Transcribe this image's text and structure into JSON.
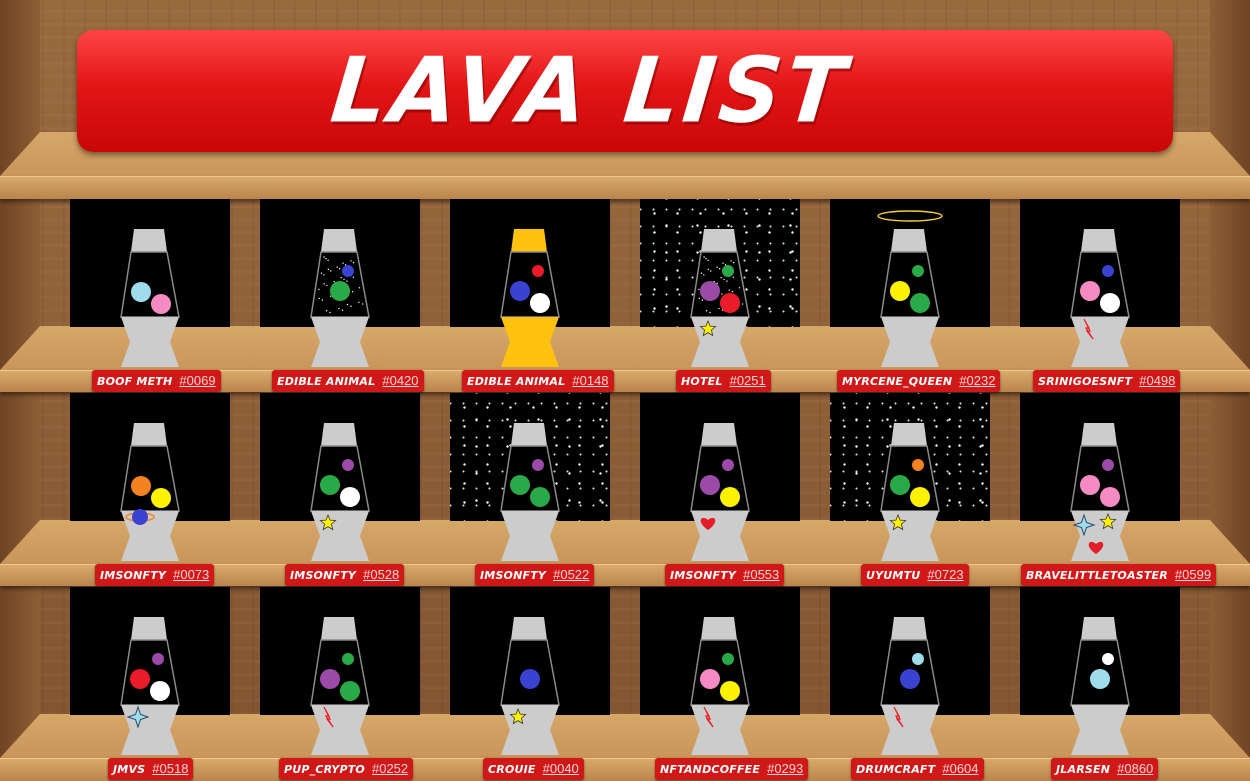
{
  "title": "LAVA LIST",
  "colors": {
    "banner": "#e31616",
    "tag": "#d01818",
    "glass": "#cccccc",
    "gold": "#ffc20e",
    "shelf": "#d6a868"
  },
  "lamps": [
    {
      "owner": "BOOF METH",
      "number": "#0069",
      "background": "black",
      "cap": "silver",
      "halo": false,
      "glitter": false,
      "blobs": [
        {
          "color": "#9fdcec",
          "size": "small"
        },
        {
          "color": "#f68bc4",
          "size": "small"
        }
      ],
      "decals": []
    },
    {
      "owner": "EDIBLE ANIMAL",
      "number": "#0420",
      "background": "black",
      "cap": "silver",
      "halo": false,
      "glitter": true,
      "blobs": [
        {
          "color": "#3a43d1",
          "size": "tiny"
        },
        {
          "color": "#29a948",
          "size": "small"
        }
      ],
      "decals": []
    },
    {
      "owner": "EDIBLE ANIMAL",
      "number": "#0148",
      "background": "black",
      "cap": "gold",
      "halo": false,
      "glitter": false,
      "blobs": [
        {
          "color": "#ea1c2a",
          "size": "tiny"
        },
        {
          "color": "#3a43d1",
          "size": "small"
        },
        {
          "color": "#ffffff",
          "size": "small"
        }
      ],
      "decals": []
    },
    {
      "owner": "HOTEL",
      "number": "#0251",
      "background": "stars",
      "cap": "silver",
      "halo": false,
      "glitter": true,
      "blobs": [
        {
          "color": "#29a948",
          "size": "tiny"
        },
        {
          "color": "#9b4aa8",
          "size": "small"
        },
        {
          "color": "#ea1c2a",
          "size": "small"
        }
      ],
      "decals": [
        "star-icon"
      ]
    },
    {
      "owner": "MYRCENE_QUEEN",
      "number": "#0232",
      "background": "black",
      "cap": "silver",
      "halo": true,
      "glitter": false,
      "blobs": [
        {
          "color": "#29a948",
          "size": "tiny"
        },
        {
          "color": "#fff200",
          "size": "small"
        },
        {
          "color": "#29a948",
          "size": "small"
        }
      ],
      "decals": []
    },
    {
      "owner": "SRINIGOESNFT",
      "number": "#0498",
      "background": "black",
      "cap": "silver",
      "halo": false,
      "glitter": false,
      "blobs": [
        {
          "color": "#3a43d1",
          "size": "tiny"
        },
        {
          "color": "#f68bc4",
          "size": "small"
        },
        {
          "color": "#ffffff",
          "size": "small"
        }
      ],
      "decals": [
        "lightning-icon"
      ]
    },
    {
      "owner": "IMSONFTY",
      "number": "#0073",
      "background": "black",
      "cap": "silver",
      "halo": false,
      "glitter": false,
      "blobs": [
        {
          "color": "#f58220",
          "size": "small"
        },
        {
          "color": "#fff200",
          "size": "small"
        }
      ],
      "decals": [
        "planet-icon"
      ]
    },
    {
      "owner": "IMSONFTY",
      "number": "#0528",
      "background": "black",
      "cap": "silver",
      "halo": false,
      "glitter": false,
      "blobs": [
        {
          "color": "#9b4aa8",
          "size": "tiny"
        },
        {
          "color": "#29a948",
          "size": "small"
        },
        {
          "color": "#ffffff",
          "size": "small"
        }
      ],
      "decals": [
        "star-icon"
      ]
    },
    {
      "owner": "IMSONFTY",
      "number": "#0522",
      "background": "stars",
      "cap": "silver",
      "halo": false,
      "glitter": false,
      "blobs": [
        {
          "color": "#9b4aa8",
          "size": "tiny"
        },
        {
          "color": "#29a948",
          "size": "small"
        },
        {
          "color": "#29a948",
          "size": "small"
        }
      ],
      "decals": []
    },
    {
      "owner": "IMSONFTY",
      "number": "#0553",
      "background": "black",
      "cap": "silver",
      "halo": false,
      "glitter": false,
      "blobs": [
        {
          "color": "#9b4aa8",
          "size": "tiny"
        },
        {
          "color": "#9b4aa8",
          "size": "small"
        },
        {
          "color": "#fff200",
          "size": "small"
        }
      ],
      "decals": [
        "heart-icon"
      ]
    },
    {
      "owner": "UYUMTU",
      "number": "#0723",
      "background": "stars",
      "cap": "silver",
      "halo": false,
      "glitter": false,
      "blobs": [
        {
          "color": "#f58220",
          "size": "tiny"
        },
        {
          "color": "#29a948",
          "size": "small"
        },
        {
          "color": "#fff200",
          "size": "small"
        }
      ],
      "decals": [
        "star-icon"
      ]
    },
    {
      "owner": "BRAVELITTLETOASTER",
      "number": "#0599",
      "background": "black",
      "cap": "silver",
      "halo": false,
      "glitter": false,
      "blobs": [
        {
          "color": "#9b4aa8",
          "size": "tiny"
        },
        {
          "color": "#f68bc4",
          "size": "small"
        },
        {
          "color": "#f68bc4",
          "size": "small"
        }
      ],
      "decals": [
        "sparkle-icon",
        "star-icon",
        "heart-icon"
      ]
    },
    {
      "owner": "JMVS",
      "number": "#0518",
      "background": "black",
      "cap": "silver",
      "halo": false,
      "glitter": false,
      "blobs": [
        {
          "color": "#9b4aa8",
          "size": "tiny"
        },
        {
          "color": "#ea1c2a",
          "size": "small"
        },
        {
          "color": "#ffffff",
          "size": "small"
        }
      ],
      "decals": [
        "sparkle-icon"
      ]
    },
    {
      "owner": "PUP_CRYPTO",
      "number": "#0252",
      "background": "black",
      "cap": "silver",
      "halo": false,
      "glitter": false,
      "blobs": [
        {
          "color": "#29a948",
          "size": "tiny"
        },
        {
          "color": "#9b4aa8",
          "size": "small"
        },
        {
          "color": "#29a948",
          "size": "small"
        }
      ],
      "decals": [
        "lightning-icon"
      ]
    },
    {
      "owner": "CROUIE",
      "number": "#0040",
      "background": "black",
      "cap": "silver",
      "halo": false,
      "glitter": false,
      "blobs": [
        {
          "color": "#3a43d1",
          "size": "small"
        }
      ],
      "decals": [
        "star-icon"
      ]
    },
    {
      "owner": "NFTANDCOFFEE",
      "number": "#0293",
      "background": "black",
      "cap": "silver",
      "halo": false,
      "glitter": false,
      "blobs": [
        {
          "color": "#29a948",
          "size": "tiny"
        },
        {
          "color": "#f68bc4",
          "size": "small"
        },
        {
          "color": "#fff200",
          "size": "small"
        }
      ],
      "decals": [
        "lightning-icon"
      ]
    },
    {
      "owner": "DRUMCRAFT",
      "number": "#0604",
      "background": "black",
      "cap": "silver",
      "halo": false,
      "glitter": false,
      "blobs": [
        {
          "color": "#9fdcec",
          "size": "tiny"
        },
        {
          "color": "#3a43d1",
          "size": "small"
        }
      ],
      "decals": [
        "lightning-icon"
      ]
    },
    {
      "owner": "JLARSEN",
      "number": "#0860",
      "background": "black",
      "cap": "silver",
      "halo": false,
      "glitter": false,
      "blobs": [
        {
          "color": "#ffffff",
          "size": "tiny"
        },
        {
          "color": "#9fdcec",
          "size": "small"
        }
      ],
      "decals": []
    }
  ]
}
